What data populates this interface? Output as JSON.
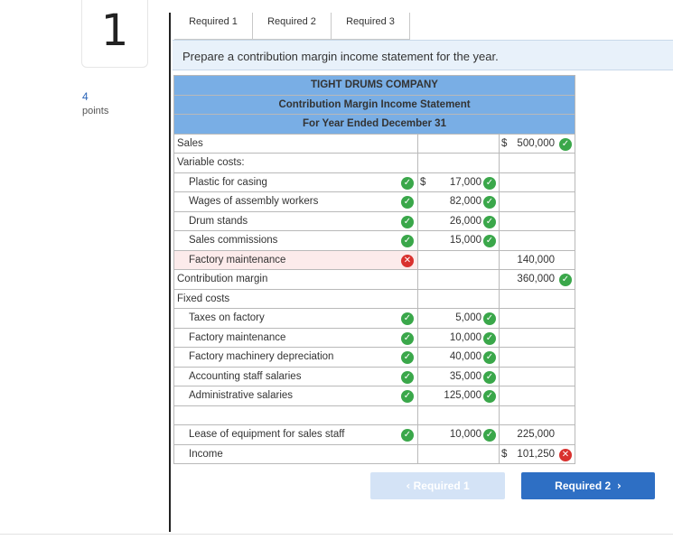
{
  "question": {
    "number": "1",
    "points_value": "4",
    "points_label": "points"
  },
  "tabs": [
    "Required 1",
    "Required 2",
    "Required 3"
  ],
  "instruction": "Prepare a contribution margin income statement for the year.",
  "statement": {
    "company": "TIGHT DRUMS COMPANY",
    "title": "Contribution Margin Income Statement",
    "period": "For Year Ended December 31",
    "rows": [
      {
        "label": "Sales",
        "indent": false,
        "mid_cur": "",
        "mid": "",
        "mid_mark": "",
        "tot_cur": "$",
        "tot": "500,000",
        "tot_mark": "ok"
      },
      {
        "label": "Variable costs:",
        "indent": false,
        "mid_cur": "",
        "mid": "",
        "mid_mark": "",
        "tot_cur": "",
        "tot": "",
        "tot_mark": ""
      },
      {
        "label": "Plastic for casing",
        "indent": true,
        "lbl_mark": "ok",
        "mid_cur": "$",
        "mid": "17,000",
        "mid_mark": "ok",
        "tot_cur": "",
        "tot": "",
        "tot_mark": ""
      },
      {
        "label": "Wages of assembly workers",
        "indent": true,
        "lbl_mark": "ok",
        "mid_cur": "",
        "mid": "82,000",
        "mid_mark": "ok",
        "tot_cur": "",
        "tot": "",
        "tot_mark": ""
      },
      {
        "label": "Drum stands",
        "indent": true,
        "lbl_mark": "ok",
        "mid_cur": "",
        "mid": "26,000",
        "mid_mark": "ok",
        "tot_cur": "",
        "tot": "",
        "tot_mark": ""
      },
      {
        "label": "Sales commissions",
        "indent": true,
        "lbl_mark": "ok",
        "mid_cur": "",
        "mid": "15,000",
        "mid_mark": "ok",
        "tot_cur": "",
        "tot": "",
        "tot_mark": ""
      },
      {
        "label": "Factory maintenance",
        "indent": true,
        "lbl_mark": "bad",
        "error": true,
        "mid_cur": "",
        "mid": "",
        "mid_mark": "",
        "tot_cur": "",
        "tot": "140,000",
        "tot_mark": ""
      },
      {
        "label": "Contribution margin",
        "indent": false,
        "mid_cur": "",
        "mid": "",
        "mid_mark": "",
        "tot_cur": "",
        "tot": "360,000",
        "tot_mark": "ok"
      },
      {
        "label": "Fixed costs",
        "indent": false,
        "mid_cur": "",
        "mid": "",
        "mid_mark": "",
        "tot_cur": "",
        "tot": "",
        "tot_mark": ""
      },
      {
        "label": "Taxes on factory",
        "indent": true,
        "lbl_mark": "ok",
        "mid_cur": "",
        "mid": "5,000",
        "mid_mark": "ok",
        "tot_cur": "",
        "tot": "",
        "tot_mark": ""
      },
      {
        "label": "Factory maintenance",
        "indent": true,
        "lbl_mark": "ok",
        "mid_cur": "",
        "mid": "10,000",
        "mid_mark": "ok",
        "tot_cur": "",
        "tot": "",
        "tot_mark": ""
      },
      {
        "label": "Factory machinery depreciation",
        "indent": true,
        "lbl_mark": "ok",
        "mid_cur": "",
        "mid": "40,000",
        "mid_mark": "ok",
        "tot_cur": "",
        "tot": "",
        "tot_mark": ""
      },
      {
        "label": "Accounting staff salaries",
        "indent": true,
        "lbl_mark": "ok",
        "mid_cur": "",
        "mid": "35,000",
        "mid_mark": "ok",
        "tot_cur": "",
        "tot": "",
        "tot_mark": ""
      },
      {
        "label": "Administrative salaries",
        "indent": true,
        "lbl_mark": "ok",
        "mid_cur": "",
        "mid": "125,000",
        "mid_mark": "ok",
        "tot_cur": "",
        "tot": "",
        "tot_mark": ""
      },
      {
        "label": "",
        "indent": true,
        "mid_cur": "",
        "mid": "",
        "mid_mark": "",
        "tot_cur": "",
        "tot": "",
        "tot_mark": ""
      },
      {
        "label": "Lease of equipment for sales staff",
        "indent": true,
        "lbl_mark": "ok",
        "mid_cur": "",
        "mid": "10,000",
        "mid_mark": "ok",
        "tot_cur": "",
        "tot": "225,000",
        "tot_mark": ""
      },
      {
        "label": "Income",
        "indent": true,
        "mid_cur": "",
        "mid": "",
        "mid_mark": "",
        "tot_cur": "$",
        "tot": "101,250",
        "tot_mark": "bad"
      }
    ]
  },
  "nav": {
    "prev_label": "Required 1",
    "next_label": "Required 2",
    "prev_chevron": "‹",
    "next_chevron": "›"
  },
  "icons": {
    "ok": "check-circle-icon",
    "bad": "x-circle-icon"
  },
  "colors": {
    "header": "#79aee5",
    "ok": "#3aa74a",
    "bad": "#d9312e",
    "next_button": "#2e6fc4",
    "prev_button": "#d4e3f6"
  }
}
